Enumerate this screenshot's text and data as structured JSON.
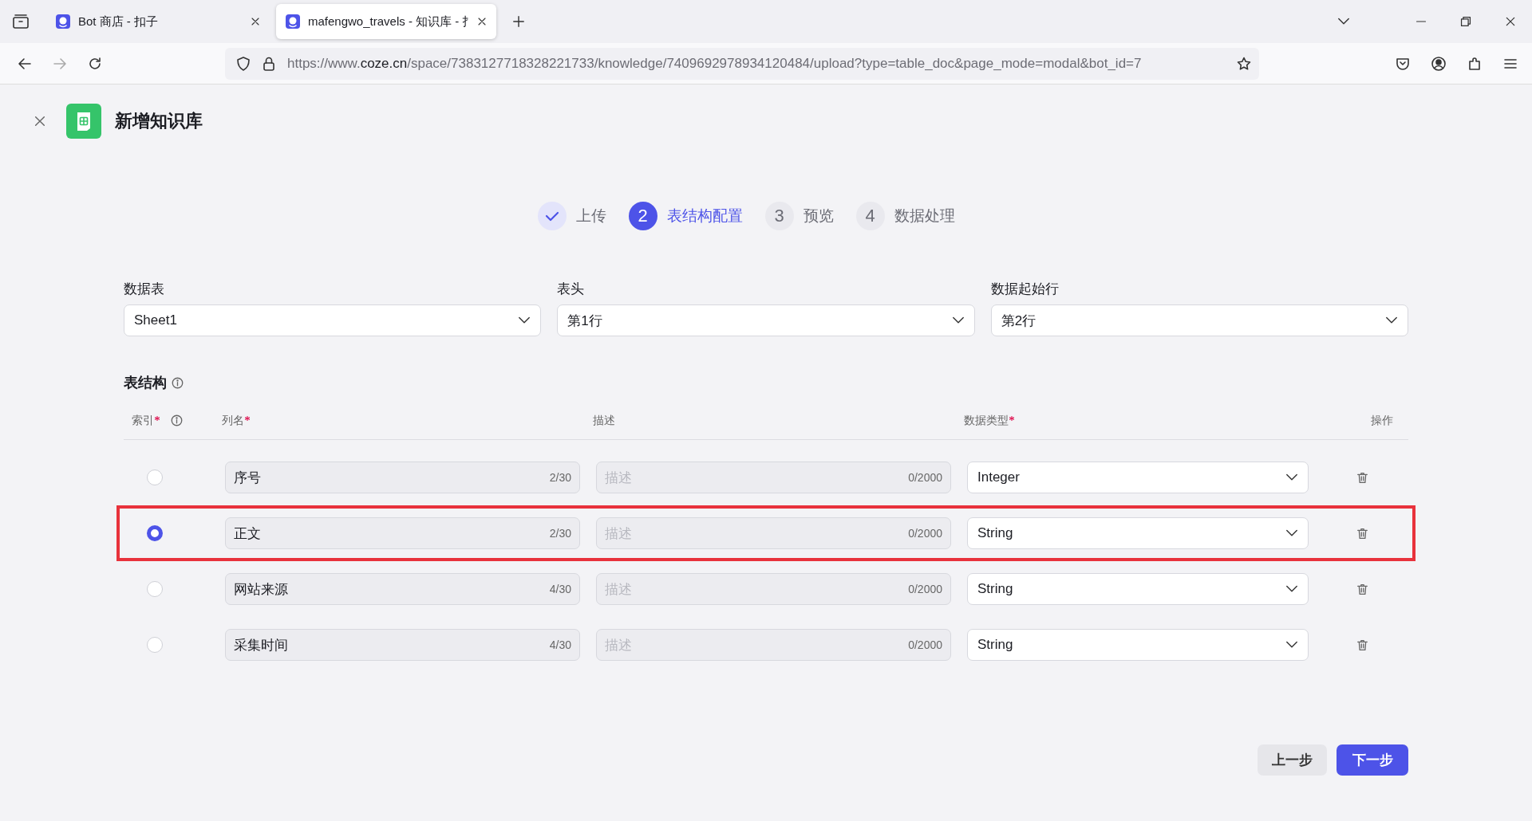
{
  "browser": {
    "tabs": [
      {
        "title": "Bot 商店 - 扣子",
        "selected": false
      },
      {
        "title": "mafengwo_travels - 知识库 - 扌",
        "selected": true
      }
    ],
    "url": {
      "host_prefix": "https://www.",
      "host": "coze.cn",
      "path": "/space/7383127718328221733/knowledge/7409692978934120484/upload?type=table_doc&page_mode=modal&bot_id=7"
    }
  },
  "page": {
    "title": "新增知识库",
    "steps": [
      {
        "label": "上传",
        "completed": true,
        "current": false
      },
      {
        "number": "2",
        "label": "表结构配置",
        "completed": false,
        "current": true
      },
      {
        "number": "3",
        "label": "预览",
        "completed": false,
        "current": false
      },
      {
        "number": "4",
        "label": "数据处理",
        "completed": false,
        "current": false
      }
    ],
    "settings": [
      {
        "label": "数据表",
        "value": "Sheet1"
      },
      {
        "label": "表头",
        "value": "第1行"
      },
      {
        "label": "数据起始行",
        "value": "第2行"
      }
    ],
    "schema": {
      "title": "表结构",
      "columns": [
        {
          "label": "索引",
          "required": true,
          "info": true
        },
        {
          "label": "列名",
          "required": true
        },
        {
          "label": "描述",
          "required": false
        },
        {
          "label": "数据类型",
          "required": true
        },
        {
          "label": "操作",
          "required": false
        }
      ],
      "rows": [
        {
          "selected": false,
          "highlighted": false,
          "name": "序号",
          "name_count": "2/30",
          "desc_placeholder": "描述",
          "desc_count": "0/2000",
          "type": "Integer"
        },
        {
          "selected": true,
          "highlighted": true,
          "name": "正文",
          "name_count": "2/30",
          "desc_placeholder": "描述",
          "desc_count": "0/2000",
          "type": "String"
        },
        {
          "selected": false,
          "highlighted": false,
          "name": "网站来源",
          "name_count": "4/30",
          "desc_placeholder": "描述",
          "desc_count": "0/2000",
          "type": "String"
        },
        {
          "selected": false,
          "highlighted": false,
          "name": "采集时间",
          "name_count": "4/30",
          "desc_placeholder": "描述",
          "desc_count": "0/2000",
          "type": "String"
        }
      ]
    },
    "buttons": [
      {
        "label": "上一步",
        "kind": "secondary"
      },
      {
        "label": "下一步",
        "kind": "primary"
      }
    ]
  }
}
